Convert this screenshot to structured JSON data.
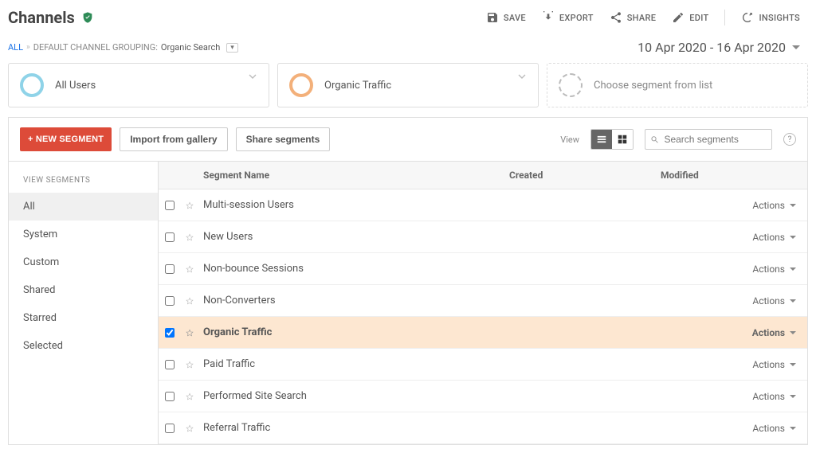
{
  "header": {
    "title": "Channels",
    "actions": {
      "save": "SAVE",
      "export": "EXPORT",
      "share": "SHARE",
      "edit": "EDIT",
      "insights": "INSIGHTS"
    }
  },
  "breadcrumb": {
    "root": "ALL",
    "group_label": "DEFAULT CHANNEL GROUPING:",
    "group_value": "Organic Search"
  },
  "date_range": "10 Apr 2020 - 16 Apr 2020",
  "segment_cards": [
    {
      "label": "All Users",
      "circle_color": "#8fd3e8"
    },
    {
      "label": "Organic Traffic",
      "circle_color": "#f3b07a"
    },
    {
      "label": "Choose segment from list",
      "placeholder": true
    }
  ],
  "toolbar": {
    "new_segment": "+ NEW SEGMENT",
    "import": "Import from gallery",
    "share": "Share segments",
    "view_label": "View",
    "search_placeholder": "Search segments"
  },
  "sidebar": {
    "heading": "VIEW SEGMENTS",
    "items": [
      "All",
      "System",
      "Custom",
      "Shared",
      "Starred",
      "Selected"
    ],
    "active_index": 0
  },
  "table": {
    "columns": {
      "name": "Segment Name",
      "created": "Created",
      "modified": "Modified",
      "actions": "Actions"
    },
    "rows": [
      {
        "name": "Multi-session Users",
        "checked": false
      },
      {
        "name": "New Users",
        "checked": false
      },
      {
        "name": "Non-bounce Sessions",
        "checked": false
      },
      {
        "name": "Non-Converters",
        "checked": false
      },
      {
        "name": "Organic Traffic",
        "checked": true
      },
      {
        "name": "Paid Traffic",
        "checked": false
      },
      {
        "name": "Performed Site Search",
        "checked": false
      },
      {
        "name": "Referral Traffic",
        "checked": false
      }
    ]
  }
}
